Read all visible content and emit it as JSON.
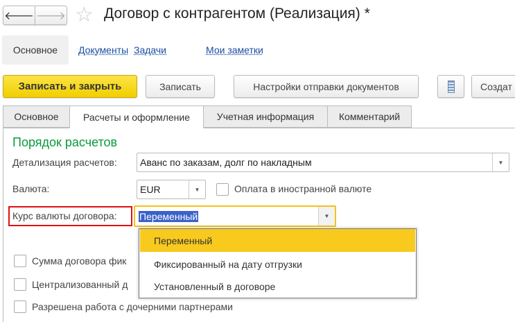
{
  "header": {
    "title": "Договор с контрагентом (Реализация) *",
    "back_icon": "arrow-left-icon",
    "forward_icon": "arrow-right-icon",
    "favorite_icon": "star-icon"
  },
  "nav": {
    "items": [
      "Основное",
      "Документы",
      "Задачи",
      "Мои заметки"
    ]
  },
  "toolbar": {
    "save_close": "Записать и закрыть",
    "save": "Записать",
    "send_settings": "Настройки отправки документов",
    "create": "Создат",
    "menu_icon": "list-icon",
    "accent": "#f5d30a"
  },
  "tabs": [
    "Основное",
    "Расчеты и оформление",
    "Учетная информация",
    "Комментарий"
  ],
  "section": {
    "title": "Порядок расчетов",
    "color": "#0a9a3a"
  },
  "form": {
    "detail_label": "Детализация расчетов:",
    "detail_value": "Аванс по заказам, долг по накладным",
    "currency_label": "Валюта:",
    "currency_value": "EUR",
    "foreign_payment_label": "Оплата в иностранной валюте",
    "rate_label": "Курс валюты договора:",
    "rate_value": "Переменный",
    "checkboxes": [
      "Сумма договора фик",
      "Централизованный д",
      "Разрешена работа с дочерними партнерами"
    ]
  },
  "dropdown": {
    "options": [
      "Переменный",
      "Фиксированный на дату отгрузки",
      "Установленный в договоре"
    ],
    "selected": "Переменный",
    "highlight": "#f8ca1e"
  }
}
